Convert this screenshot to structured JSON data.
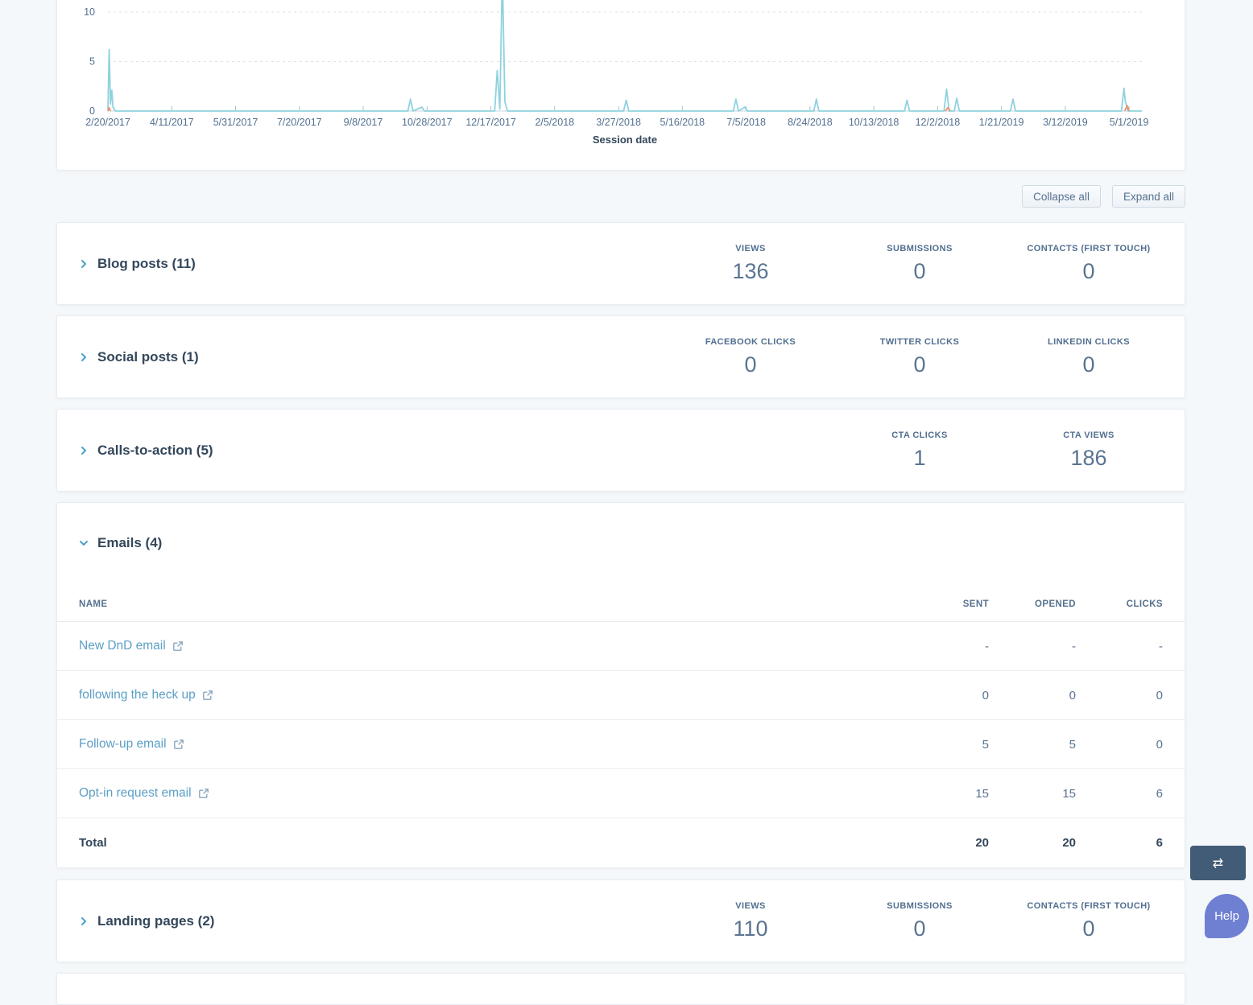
{
  "chart_data": {
    "type": "line",
    "title": "",
    "xlabel": "Session date",
    "ylabel": "",
    "yticks": [
      0,
      5,
      10
    ],
    "ylim": [
      0,
      14
    ],
    "xlim_days": [
      0,
      810
    ],
    "x_tick_interval_days": 50,
    "x_tick_labels": [
      "2/20/2017",
      "4/11/2017",
      "5/31/2017",
      "7/20/2017",
      "9/8/2017",
      "10/28/2017",
      "12/17/2017",
      "2/5/2018",
      "3/27/2018",
      "5/16/2018",
      "7/5/2018",
      "8/24/2018",
      "10/13/2018",
      "12/2/2018",
      "1/21/2019",
      "3/12/2019",
      "5/1/2019"
    ],
    "grid": true,
    "legend": false,
    "series": [
      {
        "name": "sessions",
        "color": "#8fd2de",
        "points": [
          [
            0,
            0.1
          ],
          [
            1,
            6.2
          ],
          [
            2,
            0.7
          ],
          [
            3,
            2.1
          ],
          [
            4,
            0.4
          ],
          [
            6,
            0
          ],
          [
            235,
            0
          ],
          [
            237,
            1.2
          ],
          [
            239,
            0
          ],
          [
            246,
            0.4
          ],
          [
            248,
            0
          ],
          [
            303,
            0
          ],
          [
            305,
            4.1
          ],
          [
            307,
            0.2
          ],
          [
            309,
            14
          ],
          [
            311,
            0.9
          ],
          [
            313,
            0
          ],
          [
            404,
            0
          ],
          [
            406,
            1.1
          ],
          [
            408,
            0
          ],
          [
            490,
            0
          ],
          [
            492,
            1.2
          ],
          [
            494,
            0
          ],
          [
            499,
            0.4
          ],
          [
            501,
            0
          ],
          [
            553,
            0
          ],
          [
            555,
            1.2
          ],
          [
            557,
            0
          ],
          [
            624,
            0
          ],
          [
            626,
            1.1
          ],
          [
            628,
            0
          ],
          [
            655,
            0
          ],
          [
            657,
            2.2
          ],
          [
            659,
            0
          ],
          [
            663,
            0
          ],
          [
            665,
            1.3
          ],
          [
            667,
            0
          ],
          [
            707,
            0
          ],
          [
            709,
            1.2
          ],
          [
            711,
            0
          ],
          [
            794,
            0
          ],
          [
            796,
            2.3
          ],
          [
            797,
            1.0
          ],
          [
            799,
            0
          ],
          [
            810,
            0
          ]
        ]
      },
      {
        "name": "secondary-a",
        "color": "#f0936c",
        "points": [
          [
            0,
            0
          ],
          [
            1,
            0.35
          ],
          [
            2,
            0
          ]
        ]
      },
      {
        "name": "secondary-b",
        "color": "#f0936c",
        "points": [
          [
            656,
            0
          ],
          [
            658,
            0.35
          ],
          [
            660,
            0
          ]
        ]
      },
      {
        "name": "secondary-c",
        "color": "#f0936c",
        "points": [
          [
            796.5,
            0
          ],
          [
            798.5,
            0.55
          ],
          [
            800,
            0
          ]
        ]
      }
    ]
  },
  "toolbar": {
    "collapse_all": "Collapse all",
    "expand_all": "Expand all"
  },
  "sections": [
    {
      "id": "blog-posts",
      "title": "Blog posts (11)",
      "expanded": false,
      "metrics": [
        {
          "label": "VIEWS",
          "value": "136"
        },
        {
          "label": "SUBMISSIONS",
          "value": "0"
        },
        {
          "label": "CONTACTS (FIRST TOUCH)",
          "value": "0"
        }
      ]
    },
    {
      "id": "social-posts",
      "title": "Social posts (1)",
      "expanded": false,
      "metrics": [
        {
          "label": "FACEBOOK CLICKS",
          "value": "0"
        },
        {
          "label": "TWITTER CLICKS",
          "value": "0"
        },
        {
          "label": "LINKEDIN CLICKS",
          "value": "0"
        }
      ]
    },
    {
      "id": "calls-to-action",
      "title": "Calls-to-action (5)",
      "expanded": false,
      "metrics": [
        {
          "label": "CTA CLICKS",
          "value": "1"
        },
        {
          "label": "CTA VIEWS",
          "value": "186"
        }
      ]
    },
    {
      "id": "emails",
      "title": "Emails (4)",
      "expanded": true,
      "table": {
        "columns": [
          "NAME",
          "SENT",
          "OPENED",
          "CLICKS"
        ],
        "rows": [
          {
            "name": "New DnD email",
            "values": [
              "-",
              "-",
              "-"
            ]
          },
          {
            "name": "following the heck up",
            "values": [
              "0",
              "0",
              "0"
            ]
          },
          {
            "name": "Follow-up email",
            "values": [
              "5",
              "5",
              "0"
            ]
          },
          {
            "name": "Opt-in request email",
            "values": [
              "15",
              "15",
              "6"
            ]
          }
        ],
        "total": {
          "label": "Total",
          "values": [
            "20",
            "20",
            "6"
          ]
        }
      }
    },
    {
      "id": "landing-pages",
      "title": "Landing pages (2)",
      "expanded": false,
      "metrics": [
        {
          "label": "VIEWS",
          "value": "110"
        },
        {
          "label": "SUBMISSIONS",
          "value": "0"
        },
        {
          "label": "CONTACTS (FIRST TOUCH)",
          "value": "0"
        }
      ]
    }
  ],
  "floating": {
    "toggle_icon": "⇄",
    "help_label": "Help"
  },
  "colors": {
    "link": "#5b9fc5",
    "chart_line": "#8fd2de",
    "chart_secondary": "#f0936c",
    "accent_chevron": "#4ba2c8",
    "toggle_button": "#425b76",
    "help_button": "#6f7fd2"
  }
}
